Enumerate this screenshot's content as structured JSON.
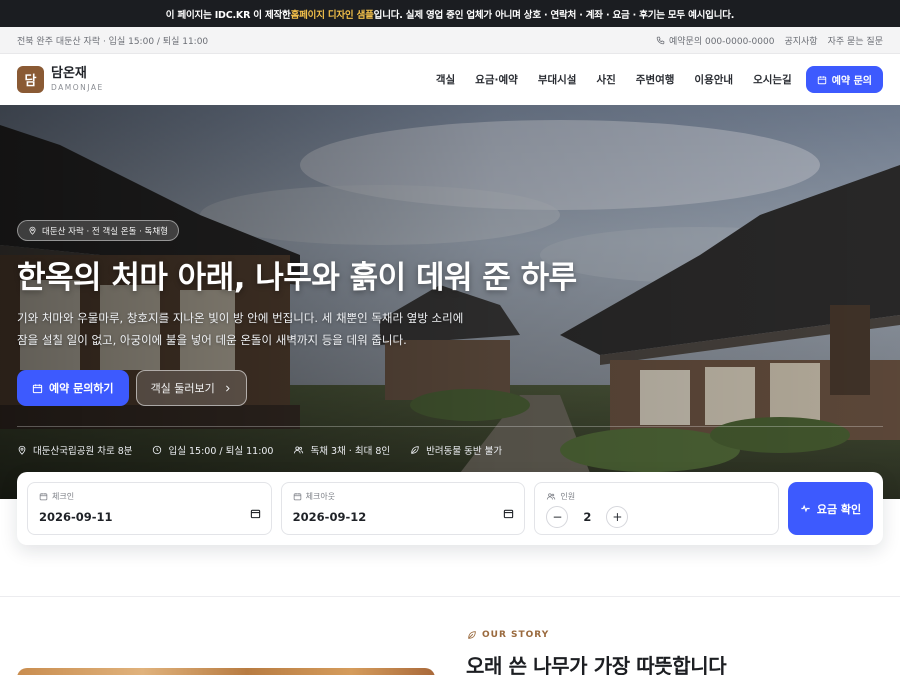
{
  "notice": {
    "pre": "이 페이지는 IDC.KR 이 제작한 ",
    "highlight": "홈페이지 디자인 샘플",
    "post": "입니다. 실제 영업 중인 업체가 아니며 상호 · 연락처 · 계좌 · 요금 · 후기는 모두 예시입니다."
  },
  "topbar": {
    "left": "전북 완주 대둔산 자락 · 입실 15:00 / 퇴실 11:00",
    "phone": "예약문의 000-0000-0000",
    "notice_link": "공지사항",
    "faq_link": "자주 묻는 질문"
  },
  "brand": {
    "mark": "담",
    "name_ko": "담온재",
    "name_en": "DAMONJAE",
    "color": "#8a5a34"
  },
  "menu": {
    "items": [
      "객실",
      "요금·예약",
      "부대시설",
      "사진",
      "주변여행",
      "이용안내",
      "오시는길"
    ],
    "cta": "예약 문의"
  },
  "hero": {
    "badge": "대둔산 자락 · 전 객실 온돌 · 독채형",
    "title": "한옥의 처마 아래, 나무와 흙이 데워 준 하루",
    "desc": "기와 처마와 우물마루, 창호지를 지나온 빛이 방 안에 번집니다. 세 채뿐인 독채라 옆방 소리에 잠을 설칠 일이 없고, 아궁이에 불을 넣어 데운 온돌이 새벽까지 등을 데워 줍니다.",
    "primary_btn": "예약 문의하기",
    "ghost_btn": "객실 둘러보기",
    "facts": [
      "대둔산국립공원 차로 8분",
      "입실 15:00 / 퇴실 11:00",
      "독채 3채 · 최대 8인",
      "반려동물 동반 불가"
    ]
  },
  "booking": {
    "checkin_label": "체크인",
    "checkin_value": "2026-09-11",
    "checkout_label": "체크아웃",
    "checkout_value": "2026-09-12",
    "guests_label": "인원",
    "guests_value": "2",
    "submit": "요금 확인"
  },
  "story": {
    "eyebrow": "OUR STORY",
    "title": "오래 쓴 나무가 가장 따뜻합니다"
  },
  "colors": {
    "accent": "#3d5afe",
    "brand_brown": "#8a5a34",
    "notice_highlight": "#f3c04a"
  }
}
